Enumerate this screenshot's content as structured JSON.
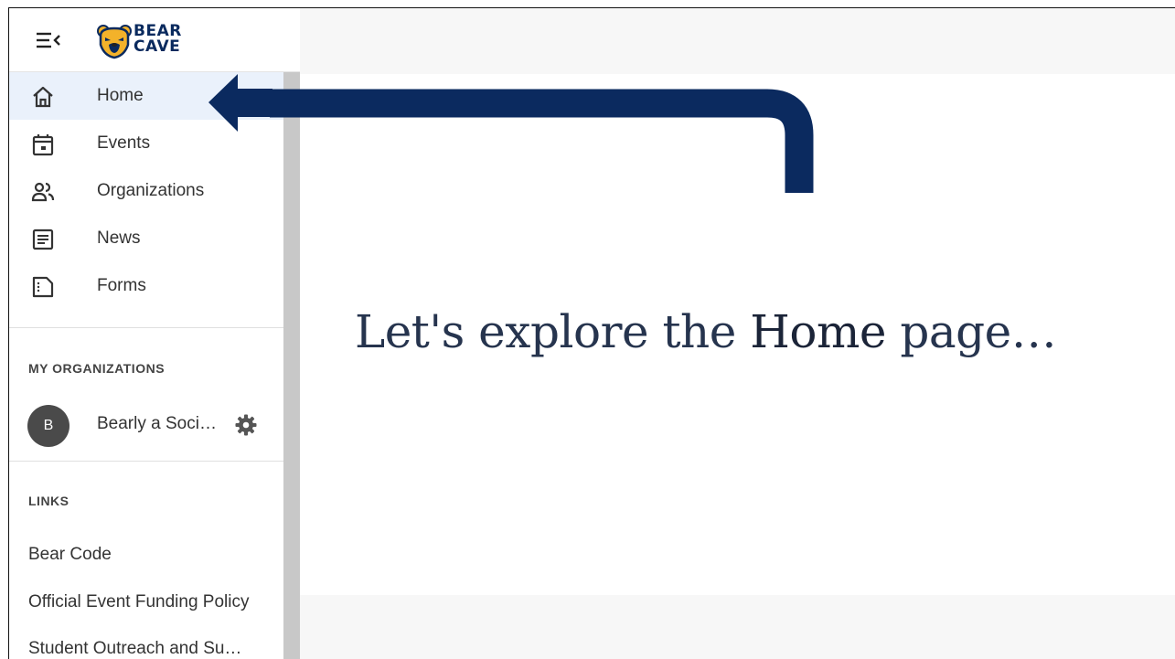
{
  "brand": {
    "line1": "BEAR",
    "line2": "CAVE"
  },
  "nav": {
    "items": [
      {
        "label": "Home",
        "icon": "home-icon"
      },
      {
        "label": "Events",
        "icon": "calendar-icon"
      },
      {
        "label": "Organizations",
        "icon": "people-icon"
      },
      {
        "label": "News",
        "icon": "document-icon"
      },
      {
        "label": "Forms",
        "icon": "form-icon"
      }
    ],
    "active": "Home"
  },
  "my_organizations": {
    "title": "MY ORGANIZATIONS",
    "items": [
      {
        "initial": "B",
        "name": "Bearly a Soci…"
      }
    ]
  },
  "links": {
    "title": "LINKS",
    "items": [
      "Bear Code",
      "Official Event Funding Policy",
      "Student Outreach and Su…"
    ]
  },
  "caption": {
    "part1": "Let's explore the ",
    "emphasis": "Home",
    "part2": " page…"
  },
  "colors": {
    "arrow": "#0b2a5f",
    "active_bg": "#eaf1fb",
    "logo": "#0a2a5e",
    "logo_gold": "#f3b22a"
  }
}
